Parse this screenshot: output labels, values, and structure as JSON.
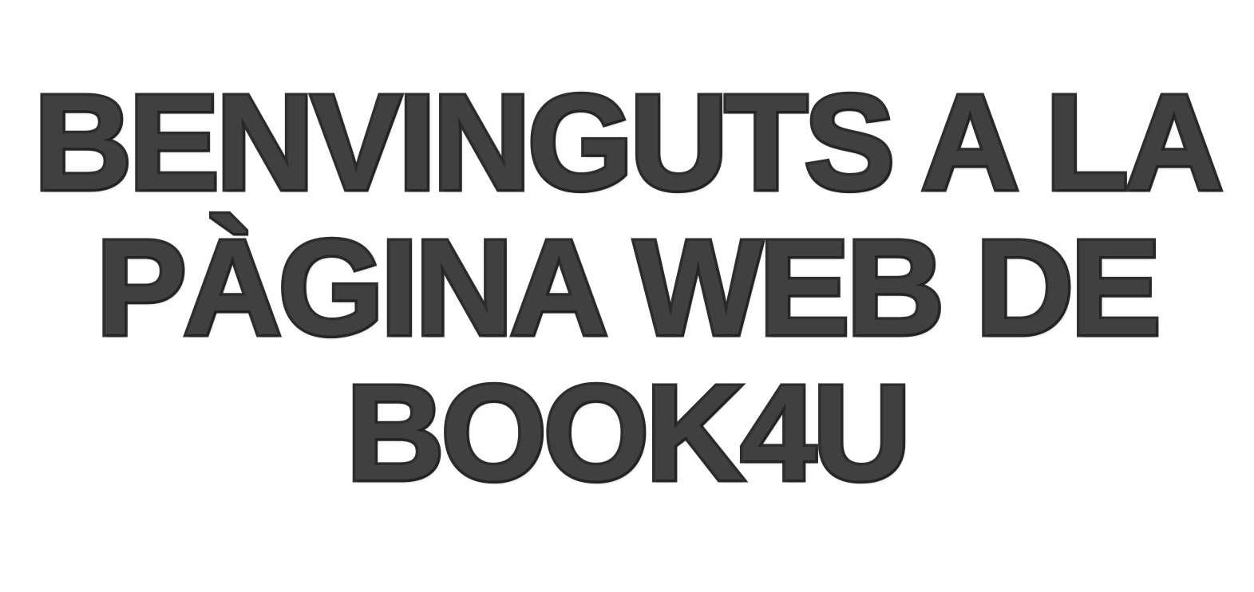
{
  "heading": {
    "line1": "BENVINGUTS A LA",
    "line2": "PÀGINA WEB DE",
    "line3": "BOOK4U"
  },
  "colors": {
    "text_fill": "#404040",
    "text_outline": "#2e2e2e",
    "background": "#ffffff"
  }
}
